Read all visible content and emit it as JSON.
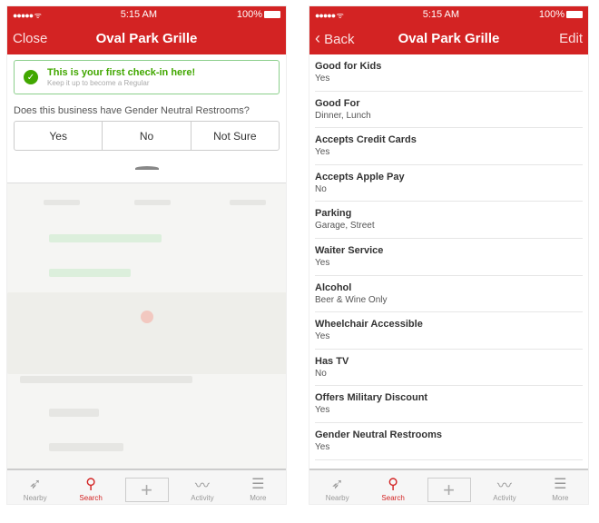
{
  "status": {
    "time": "5:15 AM",
    "battery": "100%",
    "signal": "●●●●● ᯤ"
  },
  "left": {
    "nav": {
      "left": "Close",
      "title": "Oval Park Grille"
    },
    "banner": {
      "title": "This is your first check-in here!",
      "subtitle": "Keep it up to become a Regular"
    },
    "question": "Does this business have Gender Neutral Restrooms?",
    "options": [
      "Yes",
      "No",
      "Not Sure"
    ]
  },
  "right": {
    "nav": {
      "back": "Back",
      "title": "Oval Park Grille",
      "right": "Edit"
    },
    "attributes": [
      {
        "k": "Good for Kids",
        "v": "Yes"
      },
      {
        "k": "Good For",
        "v": "Dinner, Lunch"
      },
      {
        "k": "Accepts Credit Cards",
        "v": "Yes"
      },
      {
        "k": "Accepts Apple Pay",
        "v": "No"
      },
      {
        "k": "Parking",
        "v": "Garage, Street"
      },
      {
        "k": "Waiter Service",
        "v": "Yes"
      },
      {
        "k": "Alcohol",
        "v": "Beer & Wine Only"
      },
      {
        "k": "Wheelchair Accessible",
        "v": "Yes"
      },
      {
        "k": "Has TV",
        "v": "No"
      },
      {
        "k": "Offers Military Discount",
        "v": "Yes"
      },
      {
        "k": "Gender Neutral Restrooms",
        "v": "Yes"
      }
    ]
  },
  "tabs": [
    {
      "label": "Nearby",
      "icon": "compass-icon"
    },
    {
      "label": "Search",
      "icon": "search-icon",
      "active": true
    },
    {
      "label": "",
      "icon": "plus-icon"
    },
    {
      "label": "Activity",
      "icon": "activity-icon"
    },
    {
      "label": "More",
      "icon": "menu-icon"
    }
  ],
  "colors": {
    "brand": "#d32323",
    "success": "#41a700"
  }
}
